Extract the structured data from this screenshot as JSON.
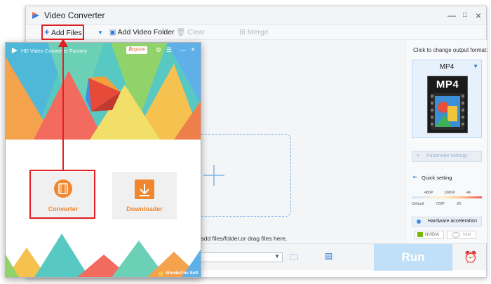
{
  "video_converter": {
    "title": "Video Converter",
    "window_controls": [
      "—",
      "□",
      "×"
    ],
    "toolbar": {
      "add_files": "Add Files",
      "add_video_folder": "Add Video Folder",
      "clear": "Clear",
      "merge": "Merge"
    },
    "drop_hint": "add files/folder,or drag files here.",
    "right_panel": {
      "caption": "Click to change output format:",
      "format": "MP4",
      "format_tile_text": "MP4",
      "parameter_settings": "Parameter settings",
      "quick_setting": "Quick setting",
      "quality_top": [
        "480P",
        "1080P",
        "4K"
      ],
      "quality_bottom": [
        "Default",
        "720P",
        "2K"
      ],
      "hardware_acceleration": "Hardware acceleration",
      "nvidia": "NVIDIA",
      "intel": "Intel"
    },
    "run": "Run"
  },
  "hd_window": {
    "title": "HD Video Converter Factory",
    "upgrade": "Upgrade",
    "window_controls": [
      "—",
      "×"
    ],
    "modules": {
      "converter": "Converter",
      "downloader": "Downloader"
    },
    "brand": "WonderFox Soft"
  },
  "colors": {
    "accent_orange": "#f0862e",
    "annotation_red": "#e02020",
    "run_disabled": "#bfe0f8",
    "primary_blue": "#2a7ad3"
  }
}
